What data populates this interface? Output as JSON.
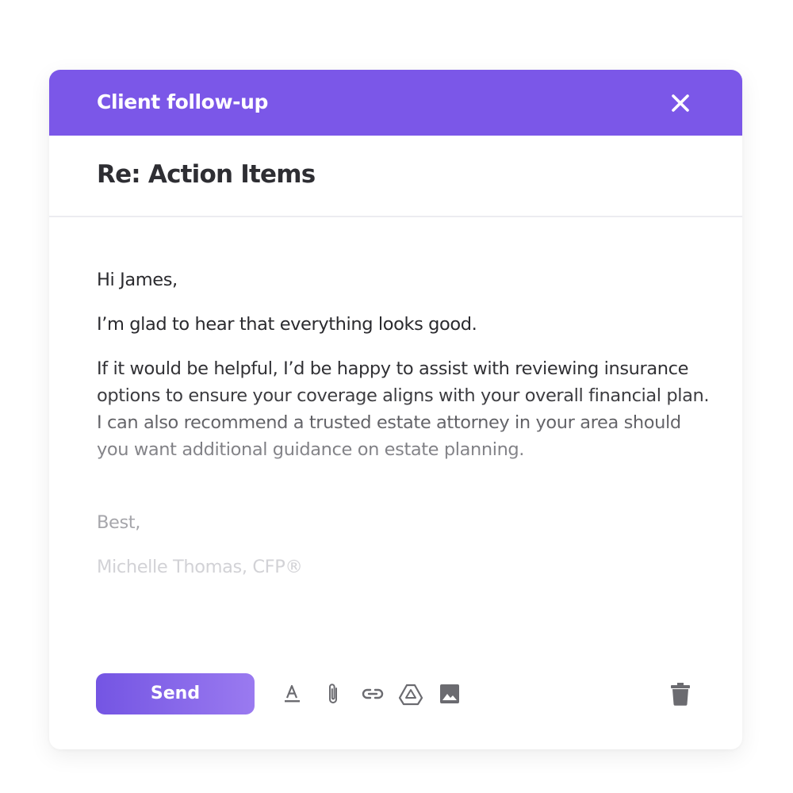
{
  "window": {
    "title": "Client follow-up",
    "close_icon": "close-icon"
  },
  "subject": "Re: Action Items",
  "message": {
    "greeting": "Hi James,",
    "line1": "I’m glad to hear that everything looks good.",
    "paragraph": "If it would be helpful, I’d be happy to assist with reviewing insurance options to ensure your coverage aligns with your overall financial plan. I can also recommend a trusted estate attorney in your area should you want additional guidance on estate planning.",
    "signoff": "Best,",
    "signature": "Michelle Thomas, CFP®"
  },
  "toolbar": {
    "send_label": "Send",
    "icons": [
      "text-format-icon",
      "attachment-icon",
      "link-icon",
      "drive-icon",
      "image-icon",
      "trash-icon"
    ]
  },
  "colors": {
    "accent": "#7b57e8",
    "send_gradient_start": "#7455e3",
    "send_gradient_end": "#9a7af0",
    "text": "#2a2a2e",
    "icon": "#6b6b70"
  }
}
